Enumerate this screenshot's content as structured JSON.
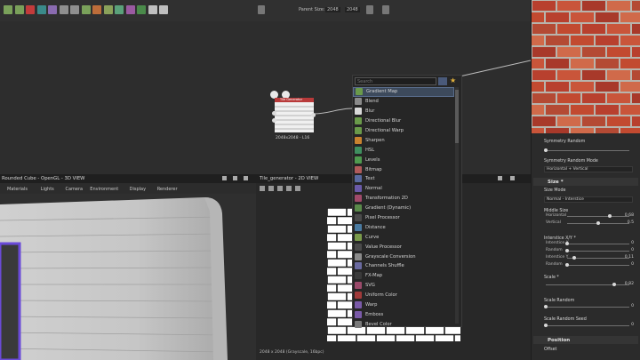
{
  "toolbar": {
    "parent_size_label": "Parent Size:",
    "size_w": "2048",
    "size_h": "2048",
    "icon_colors": [
      "#7aa15a",
      "#7aa15a",
      "#c33b3b",
      "#3a8a8a",
      "#8a6bb0",
      "#8f8f8f",
      "#8f8f8f",
      "#7aa15a",
      "#bd6d3a",
      "#8aa15a",
      "#5aa17a",
      "#9a5aa1",
      "#4a8a4a",
      "#bfbfbf",
      "#bfbfbf"
    ]
  },
  "node": {
    "title": "Tile Generator",
    "caption": "2048x2048 - L16"
  },
  "search": {
    "placeholder": "Search",
    "items": [
      {
        "label": "Gradient Map",
        "color": "#6a9a4a",
        "selected": true
      },
      {
        "label": "Blend",
        "color": "#8a8a8a"
      },
      {
        "label": "Blur",
        "color": "#d9d9d9"
      },
      {
        "label": "Directional Blur",
        "color": "#6a9a4a"
      },
      {
        "label": "Directional Warp",
        "color": "#6a9a4a"
      },
      {
        "label": "Sharpen",
        "color": "#c9822f"
      },
      {
        "label": "HSL",
        "color": "#3f8f5f"
      },
      {
        "label": "Levels",
        "color": "#4f9a4f"
      },
      {
        "label": "Bitmap",
        "color": "#b05a5a"
      },
      {
        "label": "Text",
        "color": "#5a6aa0"
      },
      {
        "label": "Normal",
        "color": "#6a5aa8"
      },
      {
        "label": "Transformation 2D",
        "color": "#a04a6a"
      },
      {
        "label": "Gradient (Dynamic)",
        "color": "#5a8a4a"
      },
      {
        "label": "Pixel Processor",
        "color": "#4a4a4a"
      },
      {
        "label": "Distance",
        "color": "#4a7aa0"
      },
      {
        "label": "Curve",
        "color": "#7a9a4a"
      },
      {
        "label": "Value Processor",
        "color": "#4a4a4a"
      },
      {
        "label": "Grayscale Conversion",
        "color": "#8a8a8a"
      },
      {
        "label": "Channels Shuffle",
        "color": "#6a6aa0"
      },
      {
        "label": "FX-Map",
        "color": "#3a3a3a"
      },
      {
        "label": "SVG",
        "color": "#9a4a6a"
      },
      {
        "label": "Uniform Color",
        "color": "#a03a3a"
      },
      {
        "label": "Warp",
        "color": "#7a5aa8"
      },
      {
        "label": "Emboss",
        "color": "#7a5aa8"
      },
      {
        "label": "Bevel Color",
        "color": "#7a7a7a"
      }
    ]
  },
  "view3d": {
    "title": "Rounded Cube - OpenGL - 3D VIEW",
    "menus": [
      "Materials",
      "Lights",
      "Camera",
      "Environment",
      "Display",
      "Renderer"
    ]
  },
  "view2d": {
    "title": "Tile_generator - 2D VIEW",
    "status": "2048 x 2048 (Grayscale, 16bpc)"
  },
  "props": {
    "symmetry_random": {
      "label": "Symmetry Random",
      "value": 0.0
    },
    "symmetry_random_mode": {
      "label": "Symmetry Random Mode",
      "value": "Horizontal + Vertical"
    },
    "size_section": "Size *",
    "size_mode": {
      "label": "Size Mode",
      "value": "Normal - Interstice"
    },
    "middle_size": {
      "label": "Middle Size"
    },
    "horizontal": {
      "label": "Horizontal",
      "value": "0.68",
      "level": 0.68
    },
    "vertical": {
      "label": "Vertical",
      "value": "0.5",
      "level": 0.5
    },
    "interstice": {
      "label": "Interstice X/Y *"
    },
    "interstice_x": {
      "label": "Interstice X",
      "value": "0",
      "level": 0
    },
    "random_1": {
      "label": "Random",
      "value": "0",
      "level": 0
    },
    "interstice_y": {
      "label": "Interstice Y",
      "value": "0.11",
      "level": 0.11
    },
    "random_2": {
      "label": "Random",
      "value": "0",
      "level": 0
    },
    "scale": {
      "label": "Scale *",
      "value": "0.82",
      "level": 0.82
    },
    "scale_random": {
      "label": "Scale Random",
      "value": "0",
      "level": 0
    },
    "scale_random_seed": {
      "label": "Scale Random Seed",
      "value": "0",
      "level": 0
    },
    "position_section": "Position",
    "offset": {
      "label": "Offset"
    }
  }
}
